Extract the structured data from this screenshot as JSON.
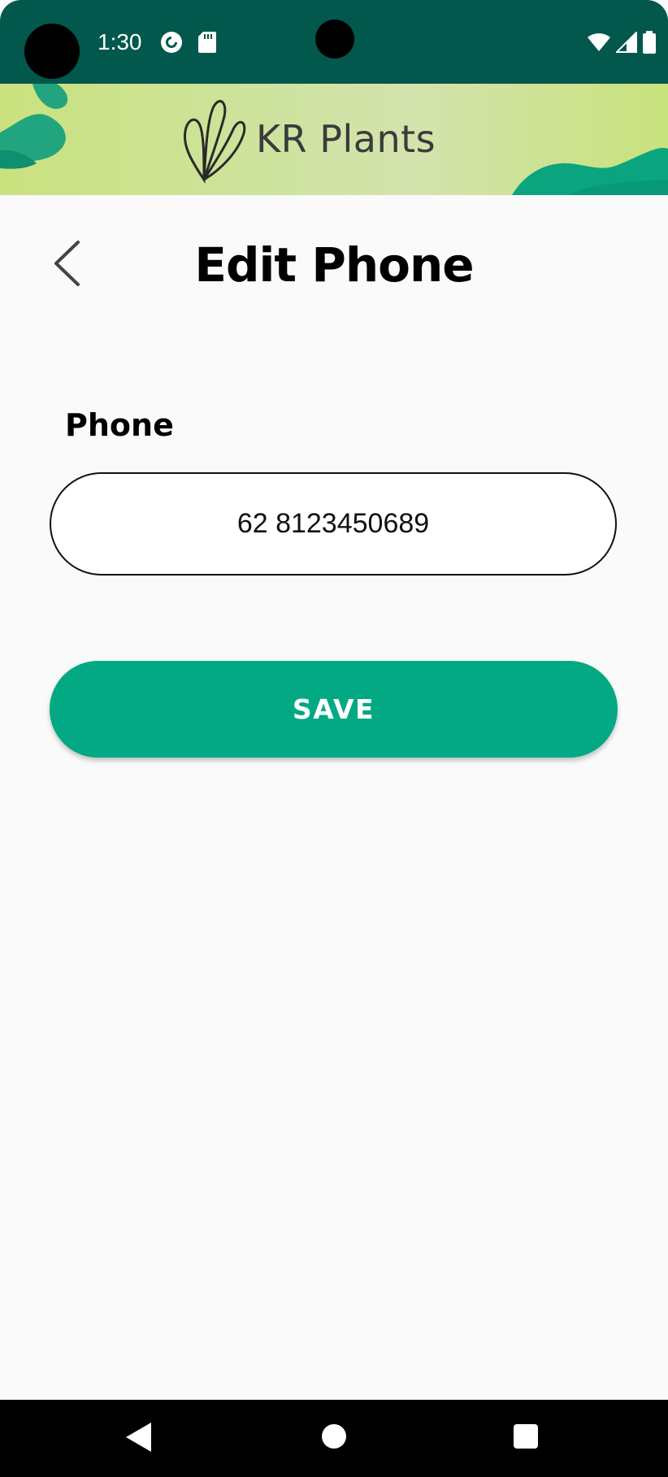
{
  "status_bar": {
    "time": "1:30",
    "icons": [
      "pocket-casts-icon",
      "sd-card-icon",
      "wifi-icon",
      "cellular-signal-icon",
      "battery-icon"
    ],
    "background_color": "#02584d"
  },
  "brand": {
    "name": "KR Plants",
    "logo_icon": "leaf-hand-logo-icon"
  },
  "header": {
    "title": "Edit Phone",
    "back_icon": "chevron-left-icon"
  },
  "form": {
    "phone_label": "Phone",
    "phone_value": "62 8123450689"
  },
  "actions": {
    "save_label": "SAVE",
    "save_color": "#02a983"
  },
  "navigation_bar": {
    "icons": [
      "nav-back-icon",
      "nav-home-icon",
      "nav-recents-icon"
    ]
  }
}
